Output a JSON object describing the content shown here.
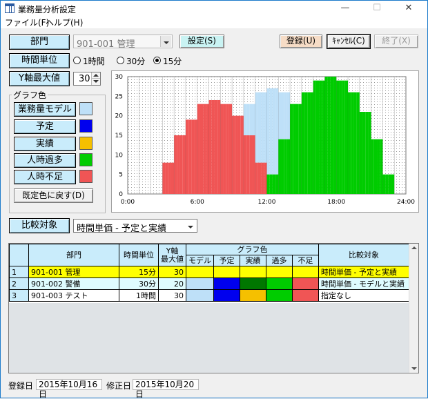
{
  "window": {
    "title": "業務量分析設定",
    "minimize": "—",
    "maximize": "☐",
    "close": "✕"
  },
  "menu": {
    "file": "ファイル(F)",
    "help": "ヘルプ(H)"
  },
  "dept": {
    "label": "部門",
    "value": "901-001  管理",
    "set_button": "設定(S)"
  },
  "actions": {
    "register": "登録(U)",
    "cancel": "ｷｬﾝｾﾙ(C)",
    "exit": "終了(X)"
  },
  "time_unit": {
    "label": "時間単位",
    "options": [
      "1時間",
      "30分",
      "15分"
    ],
    "selected_index": 2
  },
  "ymax": {
    "label": "Y軸最大値",
    "value": "30"
  },
  "graph_colors": {
    "title": "グラフ色",
    "items": [
      {
        "label": "業務量モデル",
        "color": "#bee0f8"
      },
      {
        "label": "予定",
        "color": "#0000ee"
      },
      {
        "label": "実績",
        "color": "#f5c000"
      },
      {
        "label": "人時過多",
        "color": "#00cc00"
      },
      {
        "label": "人時不足",
        "color": "#f05555"
      }
    ],
    "reset_button": "既定色に戻す(D)"
  },
  "compare": {
    "label": "比較対象",
    "value": "時間単価 - 予定と実績"
  },
  "chart_data": {
    "type": "bar",
    "yticks": [
      "0",
      "5",
      "10",
      "15",
      "20",
      "25",
      "30"
    ],
    "xticks": [
      "0:00",
      "6:00",
      "12:00",
      "18:00",
      "24:00"
    ],
    "ylim": [
      0,
      30
    ],
    "bin": "15分",
    "start_hour": 3.0,
    "bars": [
      {
        "color": "red",
        "value": 8
      },
      {
        "color": "red",
        "value": 8
      },
      {
        "color": "red",
        "value": 8
      },
      {
        "color": "red",
        "value": 8
      },
      {
        "color": "red",
        "value": 15
      },
      {
        "color": "red",
        "value": 15
      },
      {
        "color": "red",
        "value": 15
      },
      {
        "color": "red",
        "value": 15
      },
      {
        "color": "red",
        "value": 19
      },
      {
        "color": "red",
        "value": 19
      },
      {
        "color": "red",
        "value": 19
      },
      {
        "color": "red",
        "value": 19
      },
      {
        "color": "red",
        "value": 23
      },
      {
        "color": "red",
        "value": 23
      },
      {
        "color": "red",
        "value": 23
      },
      {
        "color": "red",
        "value": 23
      },
      {
        "color": "red",
        "value": 24
      },
      {
        "color": "red",
        "value": 24
      },
      {
        "color": "red",
        "value": 24
      },
      {
        "color": "red",
        "value": 24
      },
      {
        "color": "red",
        "value": 23
      },
      {
        "color": "red",
        "value": 23
      },
      {
        "color": "red",
        "value": 23
      },
      {
        "color": "red",
        "value": 23
      },
      {
        "color": "red",
        "value": 20,
        "model": 20
      },
      {
        "color": "red",
        "value": 20,
        "model": 20
      },
      {
        "color": "red",
        "value": 20,
        "model": 20
      },
      {
        "color": "red",
        "value": 20,
        "model": 20
      },
      {
        "color": "red",
        "value": 15,
        "model": 23
      },
      {
        "color": "red",
        "value": 15,
        "model": 23
      },
      {
        "color": "red",
        "value": 15,
        "model": 23
      },
      {
        "color": "red",
        "value": 15,
        "model": 23
      },
      {
        "color": "red",
        "value": 8,
        "model": 26
      },
      {
        "color": "red",
        "value": 8,
        "model": 26
      },
      {
        "color": "red",
        "value": 8,
        "model": 26
      },
      {
        "color": "red",
        "value": 8,
        "model": 26
      },
      {
        "color": "green",
        "value": 5,
        "model": 27
      },
      {
        "color": "green",
        "value": 5,
        "model": 27
      },
      {
        "color": "green",
        "value": 5,
        "model": 27
      },
      {
        "color": "green",
        "value": 5,
        "model": 27
      },
      {
        "color": "green",
        "value": 14,
        "model": 26
      },
      {
        "color": "green",
        "value": 14,
        "model": 26
      },
      {
        "color": "green",
        "value": 14,
        "model": 26
      },
      {
        "color": "green",
        "value": 14,
        "model": 26
      },
      {
        "color": "green",
        "value": 23,
        "model": 23
      },
      {
        "color": "green",
        "value": 23,
        "model": 23
      },
      {
        "color": "green",
        "value": 23,
        "model": 23
      },
      {
        "color": "green",
        "value": 23,
        "model": 23
      },
      {
        "color": "green",
        "value": 26
      },
      {
        "color": "green",
        "value": 26
      },
      {
        "color": "green",
        "value": 26
      },
      {
        "color": "green",
        "value": 26
      },
      {
        "color": "green",
        "value": 29
      },
      {
        "color": "green",
        "value": 29
      },
      {
        "color": "green",
        "value": 29
      },
      {
        "color": "green",
        "value": 29
      },
      {
        "color": "green",
        "value": 30
      },
      {
        "color": "green",
        "value": 30
      },
      {
        "color": "green",
        "value": 30
      },
      {
        "color": "green",
        "value": 30
      },
      {
        "color": "green",
        "value": 29
      },
      {
        "color": "green",
        "value": 29
      },
      {
        "color": "green",
        "value": 29
      },
      {
        "color": "green",
        "value": 29
      },
      {
        "color": "green",
        "value": 26
      },
      {
        "color": "green",
        "value": 26
      },
      {
        "color": "green",
        "value": 26
      },
      {
        "color": "green",
        "value": 26
      },
      {
        "color": "green",
        "value": 21
      },
      {
        "color": "green",
        "value": 21
      },
      {
        "color": "green",
        "value": 21
      },
      {
        "color": "green",
        "value": 21
      },
      {
        "color": "green",
        "value": 14
      },
      {
        "color": "green",
        "value": 14
      },
      {
        "color": "green",
        "value": 14
      },
      {
        "color": "green",
        "value": 14
      },
      {
        "color": "green",
        "value": 5
      },
      {
        "color": "green",
        "value": 5
      },
      {
        "color": "green",
        "value": 5
      },
      {
        "color": "green",
        "value": 5
      }
    ]
  },
  "table": {
    "headers": {
      "dept": "部門",
      "time_unit": "時間単位",
      "yaxis": "Y軸\n最大値",
      "colors": "グラフ色",
      "model": "モデル",
      "plan": "予定",
      "actual": "実績",
      "over": "過多",
      "short": "不足",
      "compare": "比較対象"
    },
    "rows": [
      {
        "num": "1",
        "dept": "901-001 管理",
        "unit": "15分",
        "ymax": "30",
        "bg": "#ffff00",
        "model": "#ffff00",
        "plan": "#ffff00",
        "actual": "#ffff00",
        "over": "#ffff00",
        "short": "#ffff00",
        "compare": "時間単価 - 予定と実績"
      },
      {
        "num": "2",
        "dept": "901-002 警備",
        "unit": "30分",
        "ymax": "20",
        "bg": "#dffcff",
        "model": "#bee0f8",
        "plan": "#0000ee",
        "actual": "#007700",
        "over": "#00cc00",
        "short": "#f05555",
        "compare": "時間単価 - モデルと実績"
      },
      {
        "num": "3",
        "dept": "901-003 テスト",
        "unit": "1時間",
        "ymax": "30",
        "bg": "#ffffff",
        "model": "#bee0f8",
        "plan": "#0000ee",
        "actual": "#f5c000",
        "over": "#00cc00",
        "short": "#f05555",
        "compare": "指定なし"
      }
    ]
  },
  "footer": {
    "reg_label": "登録日",
    "reg_date": "2015年10月16日",
    "mod_label": "修正日",
    "mod_date": "2015年10月20日"
  }
}
